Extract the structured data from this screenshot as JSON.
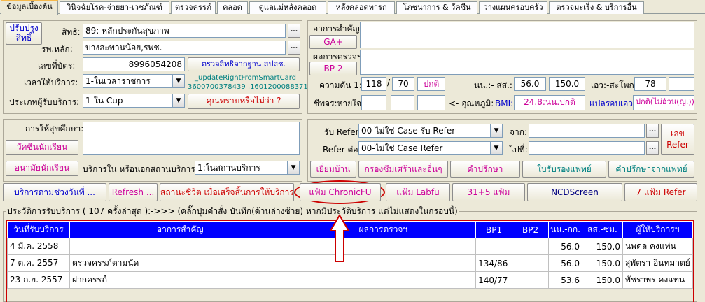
{
  "tabs": [
    "ข้อมูลเบื้องต้น",
    "วินิจฉัยโรค-จ่ายยา-เวชภัณฑ์",
    "ตรวจครรภ์",
    "คลอด",
    "ดูแลแม่หลังคลอด",
    "หลังคลอดทารก",
    "โภชนาการ & วัคซีน",
    "วางแผนครอบครัว",
    "ตรวจมะเร็ง & บริการอื่น"
  ],
  "left": {
    "update_right_btn_1": "ปรับปรุง",
    "update_right_btn_2": "สิทธิ์",
    "right_label": "สิทธิ:",
    "right_value": "89: หลักประกันสุขภาพ",
    "hosp_label": "รพ.หลัก:",
    "hosp_value": "บางสะพานน้อย,รพช.",
    "card_label": "เลขที่บัตร:",
    "card_value": "8996054208",
    "check_right_btn": "ตรวจสิทธิจากฐาน สปสช.",
    "smartcard_1": "_updateRightFromSmartCard",
    "smartcard_2": "3600700378439 ,1601200088371",
    "time_label": "เวลาให้บริการ:",
    "time_value": "1-ในเวลาราชการ",
    "type_label": "ประเภทผู้รับบริการ:",
    "type_value": "1-ใน Cup",
    "unknown_btn": "คุณทราบหรือไม่ว่า ?"
  },
  "health_ed": {
    "label": "การให้สุขศึกษา:",
    "vaccine_btn": "วัคซีนนักเรียน",
    "school_btn": "อนามัยนักเรียน",
    "place_label": "บริการใน หรือนอกสถานบริการ:",
    "place_value": "1:ในสถานบริการ"
  },
  "right": {
    "symptom_label": "อาการสำคัญ:",
    "ga_btn": "GA+",
    "result_label": "ผลการตรวจฯ:",
    "bp2_btn": "BP 2",
    "bp_label": "ความดัน 1:",
    "bp_sys": "118",
    "bp_slash": "/",
    "bp_dia": "70",
    "bp_status": "ปกติ",
    "weight_label": "นน.:- สส.:",
    "weight": "56.0",
    "height": "150.0",
    "waist_label": "เอว:-สะโพก:",
    "waist": "78",
    "pulse_label": "ชีพจร:หายใจ:",
    "temp_label": "<- อุณหภูมิ:",
    "bmi_label": "BMI:",
    "bmi_value": "24.8:นน.ปกติ",
    "waist_interp_label": "แปลรอบเอว:",
    "waist_interp": "ปกติ(ไม่อ้วน(ญ.))"
  },
  "refer": {
    "in_label": "รับ Refer:",
    "in_value": "00-ไม่ใช่ Case รับ Refer",
    "from_label": "จาก:",
    "out_label": "Refer ต่อ:",
    "out_value": "00-ไม่ใช่ Case Refer",
    "to_label": "ไปที่:",
    "refer_no_btn_1": "เลข",
    "refer_no_btn_2": "Refer",
    "actions": [
      "เยี่ยมบ้าน",
      "กรองซึมเศร้าและอื่นๆ",
      "คำปรึกษา",
      "ใบรับรองแพทย์",
      "คำปรึกษาจากแพทย์"
    ]
  },
  "toolbar": {
    "history_btn": "บริการตามช่วงวันที่ ...",
    "refresh_btn": "Refresh ...",
    "life_status_btn": "สถานะชีวิต เมื่อเสร็จสิ้นการให้บริการ",
    "chronic_btn": "แฟ้ม ChronicFU",
    "labfu_btn": "แฟ้ม Labfu",
    "files31_btn": "31+5 แฟ้ม",
    "ncd_btn": "NCDScreen",
    "files7_btn": "7 แฟ้ม Refer"
  },
  "history": {
    "title": "ประวัติการรับบริการ ( 107 ครั้งล่าสุด ):->>> (คลิ๊กปุ่มคำสั่ง บันทึก(ด้านล่างซ้าย) หากมีประวัติบริการ แต่ไม่แสดงในกรอบนี้)",
    "columns": [
      "วันที่รับบริการ",
      "อาการสำคัญ",
      "ผลการตรวจฯ",
      "BP1",
      "BP2",
      "นน.-กก.",
      "สส.-ซม.",
      "ผู้ให้บริการฯ"
    ],
    "rows": [
      [
        "4 มี.ค. 2558",
        "",
        "",
        "",
        "",
        "56.0",
        "150.0",
        "นพดล คงแท่น"
      ],
      [
        "7 ต.ค. 2557",
        "ตรวจครรภ์ตามนัด",
        "",
        "134/86",
        "",
        "56.0",
        "150.0",
        "สุพัตรา อินทมาตย์"
      ],
      [
        "23 ก.ย. 2557",
        "ฝากครรภ์",
        "",
        "140/77",
        "",
        "53.6",
        "150.0",
        "พัชราพร คงแท่น"
      ]
    ]
  },
  "colors": {
    "accent_red": "#cc0000",
    "header_blue": "#0000ff",
    "magenta": "#cc0099",
    "teal": "#008080"
  }
}
